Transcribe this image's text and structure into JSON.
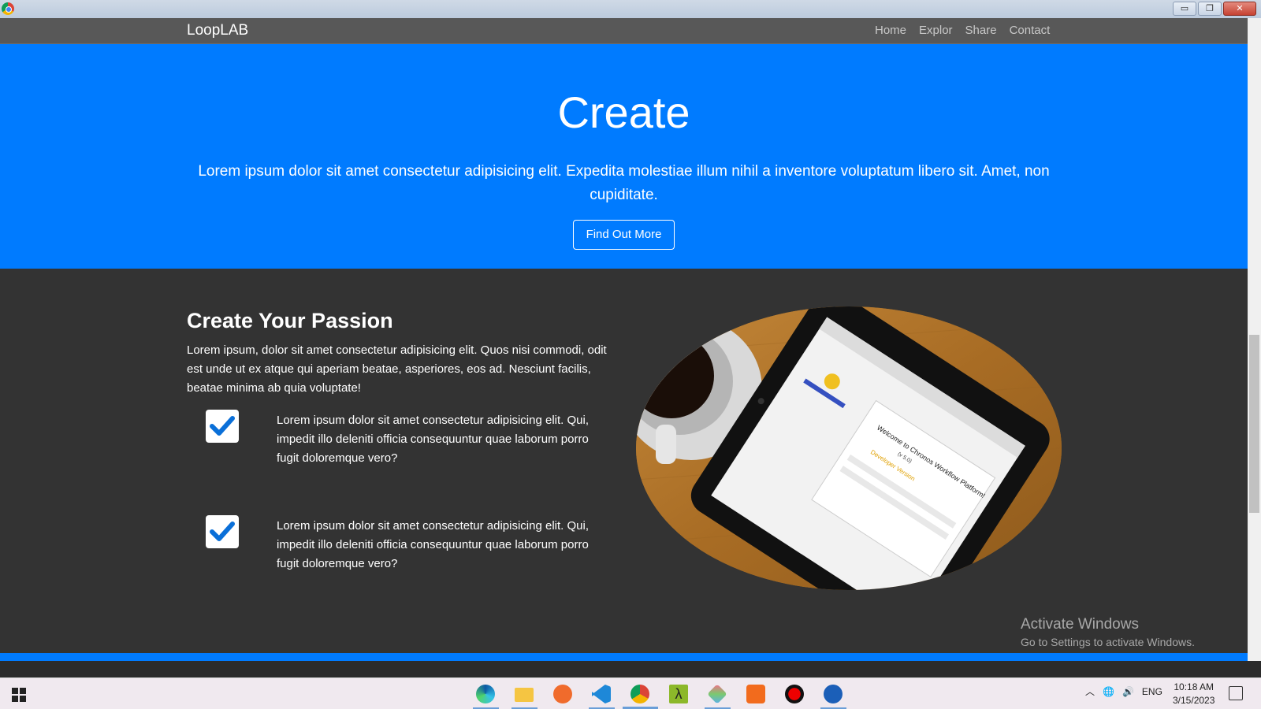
{
  "window": {
    "minimize": "▭",
    "restore": "❐",
    "close": "✕"
  },
  "navbar": {
    "brand": "LoopLAB",
    "links": [
      "Home",
      "Explor",
      "Share",
      "Contact"
    ]
  },
  "hero": {
    "title": "Create",
    "text": "Lorem ipsum dolor sit amet consectetur adipisicing elit. Expedita molestiae illum nihil a inventore voluptatum libero sit. Amet, non cupiditate.",
    "button": "Find Out More",
    "color": "#007bff"
  },
  "feature": {
    "title": "Create Your Passion",
    "lead": "Lorem ipsum, dolor sit amet consectetur adipisicing elit. Quos nisi commodi, odit est unde ut ex atque qui aperiam beatae, asperiores, eos ad. Nesciunt facilis, beatae minima ab quia voluptate!",
    "items": [
      {
        "icon": "check-icon",
        "text": "Lorem ipsum dolor sit amet consectetur adipisicing elit. Qui, impedit illo deleniti officia consequuntur quae laborum porro fugit doloremque vero?"
      },
      {
        "icon": "check-icon",
        "text": "Lorem ipsum dolor sit amet consectetur adipisicing elit. Qui, impedit illo deleniti officia consequuntur quae laborum porro fugit doloremque vero?"
      }
    ],
    "photo_tablet": {
      "heading": "Welcome to Chronos Workflow Platform!",
      "version": "(v 5.0)",
      "edition": "Developer Version"
    }
  },
  "watermark": {
    "title": "Activate Windows",
    "subtitle": "Go to Settings to activate Windows."
  },
  "taskbar": {
    "apps": [
      "edge-icon",
      "file-explorer-icon",
      "postman-icon",
      "vscode-icon",
      "chrome-icon",
      "lambda-icon",
      "git-icon",
      "xampp-icon",
      "obs-icon",
      "davinci-icon"
    ],
    "tray_language": "ENG",
    "time": "10:18 AM",
    "date": "3/15/2023"
  }
}
